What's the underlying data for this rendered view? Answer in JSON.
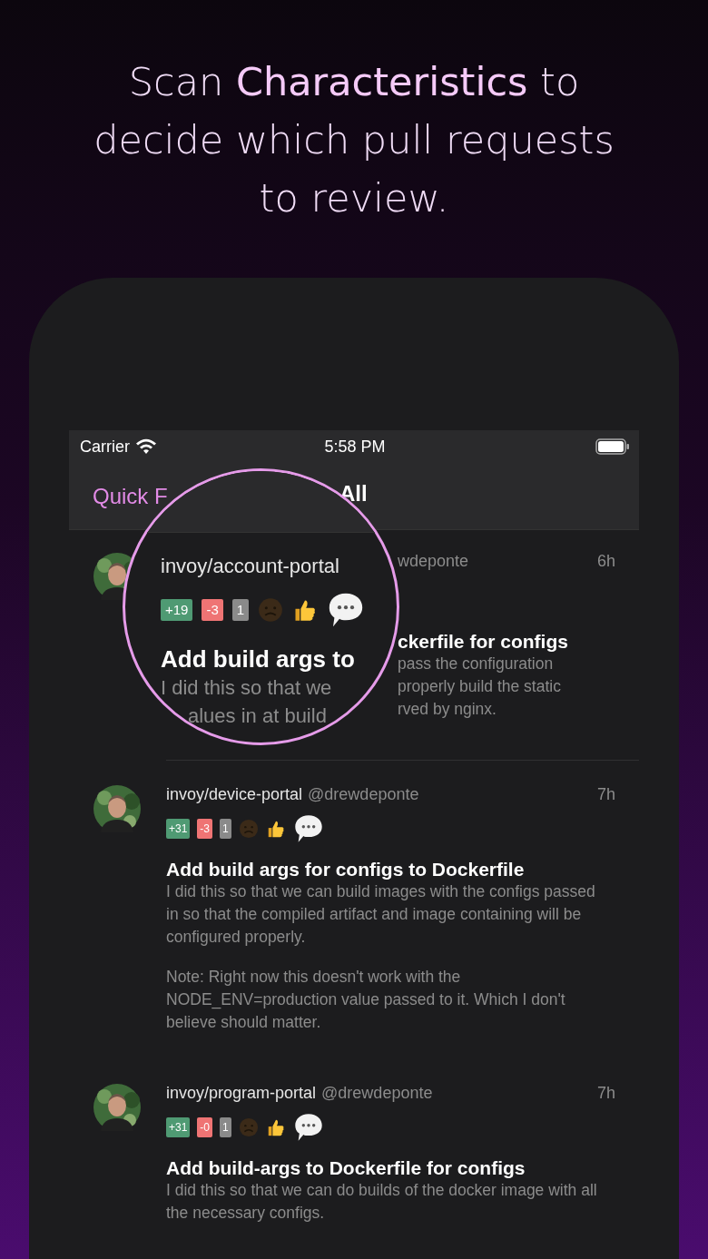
{
  "headline": "Scan **Characteristics** to decide which pull requests to review.",
  "status_bar": {
    "carrier": "Carrier",
    "time": "5:58 PM"
  },
  "nav": {
    "left": "Quick F",
    "title": "All"
  },
  "magnifier": {
    "repo": "invoy/account-portal",
    "additions": "+19",
    "deletions": "-3",
    "count": "1",
    "title": "Add build args to",
    "body": [
      "I did this so that we",
      "alues in at build"
    ]
  },
  "first_pull_request": {
    "handle": "wdeponte",
    "time": "6h",
    "title": "ckerfile for configs",
    "body": [
      "pass the configuration",
      "properly build the static",
      "rved by nginx."
    ]
  },
  "pull_requests": [
    {
      "repo": "invoy/device-portal",
      "handle": "@drewdeponte",
      "time": "7h",
      "additions": "+31",
      "deletions": "-3",
      "count": "1",
      "title": "Add build args for configs to Dockerfile",
      "body": [
        "I did this so that we can build images with the configs passed in so that the compiled artifact and image containing will be configured properly.",
        "Note: Right now this doesn't work with the NODE_ENV=production value passed to it. Which I don't believe should matter."
      ]
    },
    {
      "repo": "invoy/program-portal",
      "handle": "@drewdeponte",
      "time": "7h",
      "additions": "+31",
      "deletions": "-0",
      "count": "1",
      "title": "Add build-args to Dockerfile for configs",
      "body": [
        "I did this so that we can do builds of the docker image with all the necessary configs."
      ]
    }
  ]
}
